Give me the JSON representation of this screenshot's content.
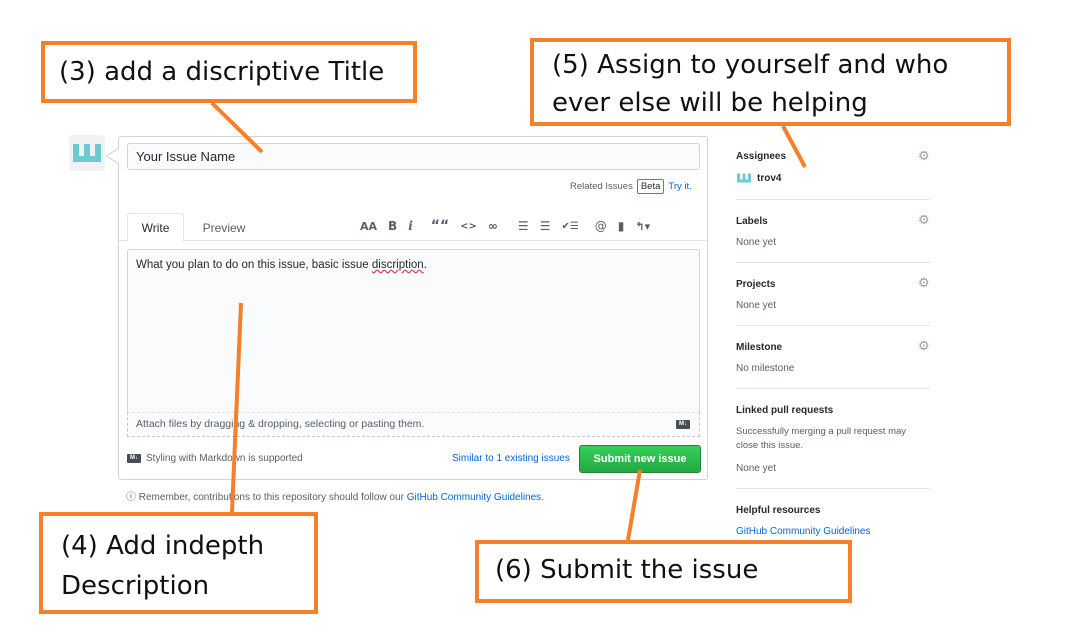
{
  "issue_form": {
    "title_value": "Your Issue Name",
    "related_issues_label": "Related Issues",
    "beta_badge": "Beta",
    "try_it_link": "Try it.",
    "tabs": [
      {
        "label": "Write"
      },
      {
        "label": "Preview"
      }
    ],
    "toolbar": {
      "heading": "AA",
      "bold": "B",
      "italic": "i",
      "quote": "““",
      "code": "<>",
      "link": "∞",
      "bullet_list": "☰",
      "numbered_list": "☰",
      "task_list": "✔☰",
      "mention": "@",
      "reference": "▮",
      "reply": "↰▾"
    },
    "body_text_prefix": "What you plan to do on this issue, basic issue ",
    "body_text_misspelled": "discription",
    "body_text_suffix": ".",
    "attach_hint": "Attach files by dragging & dropping, selecting or pasting them.",
    "markdown_note": "Styling with Markdown is supported",
    "similar_issues_link": "Similar to 1 existing issues",
    "submit_label": "Submit new issue",
    "remember_prefix": "ⓘ Remember, contributions to this repository should follow our ",
    "remember_link": "GitHub Community Guidelines",
    "remember_suffix": "."
  },
  "sidebar": {
    "assignees": {
      "title": "Assignees",
      "user": "trov4"
    },
    "labels": {
      "title": "Labels",
      "value": "None yet"
    },
    "projects": {
      "title": "Projects",
      "value": "None yet"
    },
    "milestone": {
      "title": "Milestone",
      "value": "No milestone"
    },
    "linked_prs": {
      "title": "Linked pull requests",
      "desc_line1": "Successfully merging a pull request may",
      "desc_line2": "close this issue.",
      "value": "None yet"
    },
    "helpful": {
      "title": "Helpful resources",
      "link": "GitHub Community Guidelines"
    }
  },
  "callouts": {
    "step3": "(3) add a discriptive Title",
    "step5_line1": "(5) Assign to yourself and who",
    "step5_line2": "ever else will be helping",
    "step4_line1": "(4) Add indepth",
    "step4_line2": "Description",
    "step6": "(6) Submit the issue"
  },
  "colors": {
    "callout_orange": "#f57f2a",
    "submit_green": "#28a745",
    "link_blue": "#0366d6",
    "avatar_teal": "#6bcbd0"
  },
  "icons": [
    "avatar-logo-icon",
    "gear-icon",
    "markdown-icon",
    "info-icon"
  ]
}
